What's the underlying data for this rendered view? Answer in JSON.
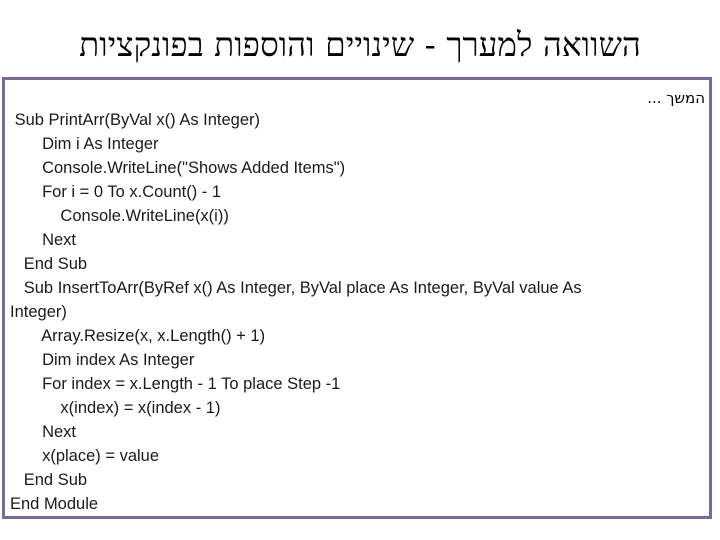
{
  "slide": {
    "title": "השוואה למערך - שינויים והוספות בפונקציות",
    "border_color": "#7a6a96"
  },
  "code_box": {
    "continue_label": "המשך ...",
    "lines": [
      " Sub PrintArr(ByVal x() As Integer)",
      "       Dim i As Integer",
      "       Console.WriteLine(\"Shows Added Items\")",
      "       For i = 0 To x.Count() - 1",
      "           Console.WriteLine(x(i))",
      "       Next",
      "   End Sub",
      "   Sub InsertToArr(ByRef x() As Integer, ByVal place As Integer, ByVal value As",
      "Integer)",
      "       Array.Resize(x, x.Length() + 1)",
      "       Dim index As Integer",
      "       For index = x.Length - 1 To place Step -1",
      "           x(index) = x(index - 1)",
      "       Next",
      "       x(place) = value",
      "   End Sub",
      "End Module"
    ]
  }
}
